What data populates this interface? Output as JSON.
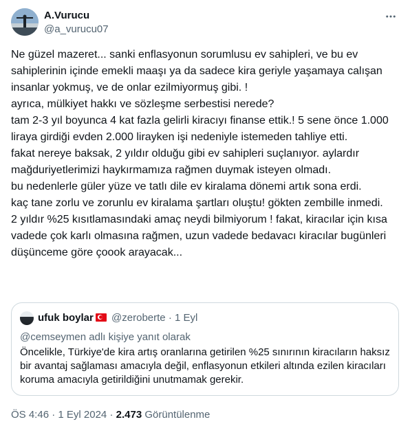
{
  "author": {
    "name": "A.Vurucu",
    "handle": "@a_vurucu07"
  },
  "tweet": {
    "text": "Ne güzel mazeret... sanki  enflasyonun sorumlusu ev sahipleri, ve bu ev sahiplerinin içinde emekli maaşı ya da sadece kira geriyle yaşamaya calışan insanlar yokmuş, ve de onlar ezilmiyormuş gibi. !\nayrıca, mülkiyet hakkı ve sözleşme serbestisi nerede?\ntam 2-3 yıl boyunca 4 kat fazla gelirli kiracıyı finanse ettik.!  5 sene önce 1.000 liraya girdiği evden 2.000 lirayken işi nedeniyle istemeden tahliye etti.\nfakat nereye baksak, 2 yıldır olduğu gibi ev sahipleri suçlanıyor. aylardır mağduriyetlerimizi haykırmamıza rağmen duymak isteyen olmadı.\nbu nedenlerle güler yüze ve tatlı dile ev kiralama dönemi artık sona erdi.\nkaç tane zorlu  ve zorunlu ev kiralama şartları oluştu! gökten zembille inmedi.\n2 yıldır  %25 kısıtlamasındaki amaç neydi bilmiyorum ! fakat, kiracılar için kısa vadede çok karlı olmasına rağmen, uzun vadede  bedavacı kiracılar bugünleri düşünceme göre çoook arayacak..."
  },
  "quoted": {
    "name": "ufuk boylar",
    "handle": "@zeroberte",
    "separator": "·",
    "date": "1 Eyl",
    "reply_context": "@cemseymen adlı kişiye yanıt olarak",
    "text": "Öncelikle, Türkiye'de kira artış oranlarına getirilen %25 sınırının kiracıların haksız bir avantaj sağlaması amacıyla değil, enflasyonun etkileri altında ezilen kiracıları koruma amacıyla getirildiğini unutmamak gerekir."
  },
  "footer": {
    "time": "ÖS 4:46",
    "separator1": "·",
    "date": "1 Eyl 2024",
    "separator2": "·",
    "views_count": "2.473",
    "views_label": "Görüntülenme"
  },
  "icons": {
    "more": "more-horizontal-icon",
    "flag": "turkey-flag-icon"
  }
}
